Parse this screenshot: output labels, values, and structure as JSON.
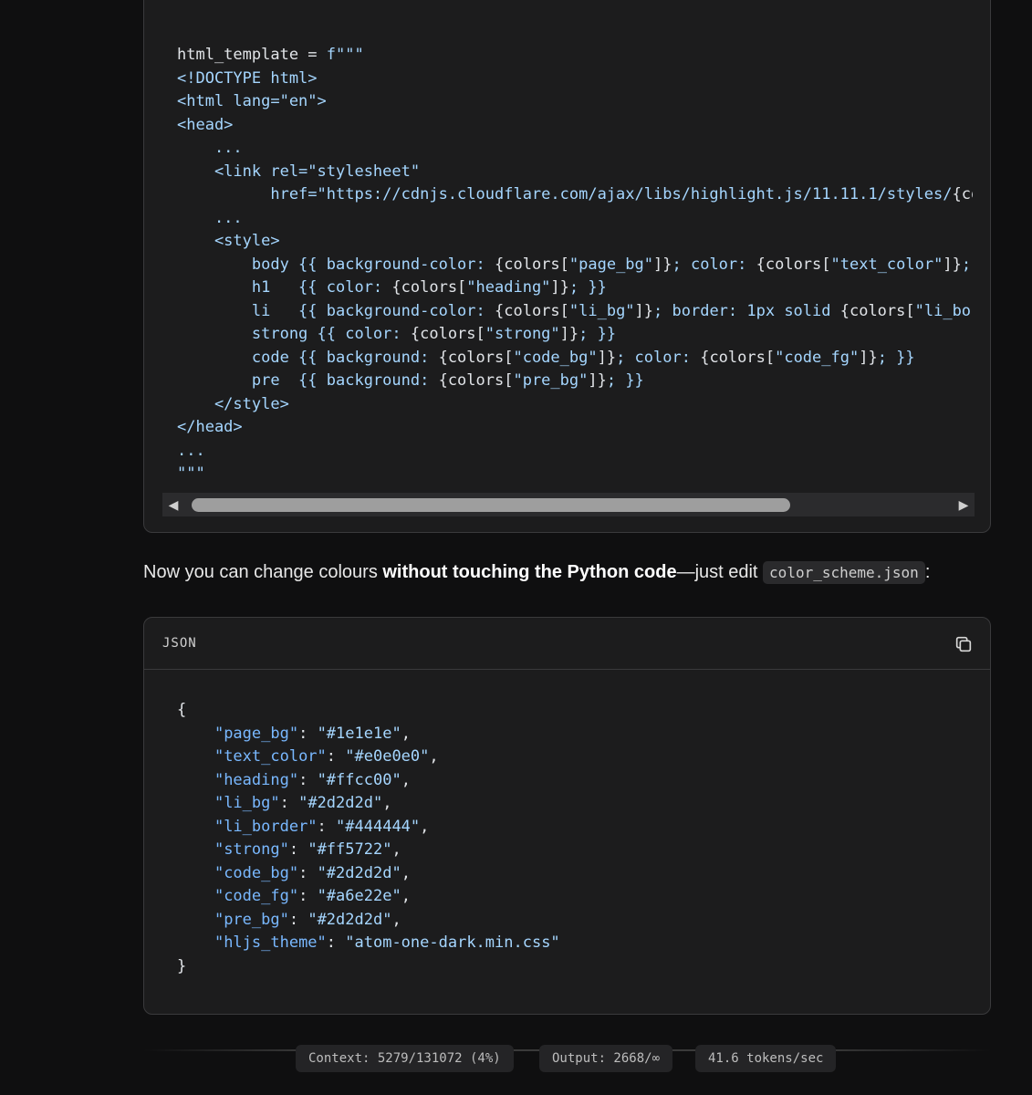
{
  "code_block_1": {
    "lines": [
      [
        {
          "t": "html_template = ",
          "c": "p"
        },
        {
          "t": "f\"\"\"",
          "c": "s"
        }
      ],
      [
        {
          "t": "<!DOCTYPE html>",
          "c": "s"
        }
      ],
      [
        {
          "t": "<html lang=\"en\">",
          "c": "s"
        }
      ],
      [
        {
          "t": "<head>",
          "c": "s"
        }
      ],
      [
        {
          "t": "    ...",
          "c": "s"
        }
      ],
      [
        {
          "t": "    <link rel=\"stylesheet\"",
          "c": "s"
        }
      ],
      [
        {
          "t": "          href=\"https://cdnjs.cloudflare.com/ajax/libs/highlight.js/11.11.1/styles/",
          "c": "s"
        },
        {
          "t": "{co",
          "c": "p"
        }
      ],
      [
        {
          "t": "    ...",
          "c": "s"
        }
      ],
      [
        {
          "t": "    <style>",
          "c": "s"
        }
      ],
      [
        {
          "t": "        body {{ background-color: ",
          "c": "s"
        },
        {
          "t": "{colors[",
          "c": "p"
        },
        {
          "t": "\"page_bg\"",
          "c": "s"
        },
        {
          "t": "]}",
          "c": "p"
        },
        {
          "t": "; color: ",
          "c": "s"
        },
        {
          "t": "{colors[",
          "c": "p"
        },
        {
          "t": "\"text_color\"",
          "c": "s"
        },
        {
          "t": "]}",
          "c": "p"
        },
        {
          "t": ";",
          "c": "s"
        }
      ],
      [
        {
          "t": "        h1   {{ color: ",
          "c": "s"
        },
        {
          "t": "{colors[",
          "c": "p"
        },
        {
          "t": "\"heading\"",
          "c": "s"
        },
        {
          "t": "]}",
          "c": "p"
        },
        {
          "t": "; }}",
          "c": "s"
        }
      ],
      [
        {
          "t": "        li   {{ background-color: ",
          "c": "s"
        },
        {
          "t": "{colors[",
          "c": "p"
        },
        {
          "t": "\"li_bg\"",
          "c": "s"
        },
        {
          "t": "]}",
          "c": "p"
        },
        {
          "t": "; border: 1px solid ",
          "c": "s"
        },
        {
          "t": "{colors[",
          "c": "p"
        },
        {
          "t": "\"li_bor",
          "c": "s"
        }
      ],
      [
        {
          "t": "        strong {{ color: ",
          "c": "s"
        },
        {
          "t": "{colors[",
          "c": "p"
        },
        {
          "t": "\"strong\"",
          "c": "s"
        },
        {
          "t": "]}",
          "c": "p"
        },
        {
          "t": "; }}",
          "c": "s"
        }
      ],
      [
        {
          "t": "        code {{ background: ",
          "c": "s"
        },
        {
          "t": "{colors[",
          "c": "p"
        },
        {
          "t": "\"code_bg\"",
          "c": "s"
        },
        {
          "t": "]}",
          "c": "p"
        },
        {
          "t": "; color: ",
          "c": "s"
        },
        {
          "t": "{colors[",
          "c": "p"
        },
        {
          "t": "\"code_fg\"",
          "c": "s"
        },
        {
          "t": "]}",
          "c": "p"
        },
        {
          "t": "; }}",
          "c": "s"
        }
      ],
      [
        {
          "t": "        pre  {{ background: ",
          "c": "s"
        },
        {
          "t": "{colors[",
          "c": "p"
        },
        {
          "t": "\"pre_bg\"",
          "c": "s"
        },
        {
          "t": "]}",
          "c": "p"
        },
        {
          "t": "; }}",
          "c": "s"
        }
      ],
      [
        {
          "t": "    </style>",
          "c": "s"
        }
      ],
      [
        {
          "t": "</head>",
          "c": "s"
        }
      ],
      [
        {
          "t": "...",
          "c": "s"
        }
      ],
      [
        {
          "t": "\"\"\"",
          "c": "s"
        }
      ]
    ],
    "scrollbar": {
      "left_arrow": "◀",
      "right_arrow": "▶",
      "thumb_fraction": 0.74
    }
  },
  "prose": {
    "before": "Now you can change colours ",
    "bold": "without touching the Python code",
    "after": "—just edit ",
    "inline_code": "color_scheme.json",
    "end": ":"
  },
  "code_block_2": {
    "language": "JSON",
    "copy_icon": "copy-icon",
    "lines": [
      [
        {
          "t": "{",
          "c": "p"
        }
      ],
      [
        {
          "t": "    ",
          "c": "p"
        },
        {
          "t": "\"page_bg\"",
          "c": "k"
        },
        {
          "t": ": ",
          "c": "p"
        },
        {
          "t": "\"#1e1e1e\"",
          "c": "s"
        },
        {
          "t": ",",
          "c": "p"
        }
      ],
      [
        {
          "t": "    ",
          "c": "p"
        },
        {
          "t": "\"text_color\"",
          "c": "k"
        },
        {
          "t": ": ",
          "c": "p"
        },
        {
          "t": "\"#e0e0e0\"",
          "c": "s"
        },
        {
          "t": ",",
          "c": "p"
        }
      ],
      [
        {
          "t": "    ",
          "c": "p"
        },
        {
          "t": "\"heading\"",
          "c": "k"
        },
        {
          "t": ": ",
          "c": "p"
        },
        {
          "t": "\"#ffcc00\"",
          "c": "s"
        },
        {
          "t": ",",
          "c": "p"
        }
      ],
      [
        {
          "t": "    ",
          "c": "p"
        },
        {
          "t": "\"li_bg\"",
          "c": "k"
        },
        {
          "t": ": ",
          "c": "p"
        },
        {
          "t": "\"#2d2d2d\"",
          "c": "s"
        },
        {
          "t": ",",
          "c": "p"
        }
      ],
      [
        {
          "t": "    ",
          "c": "p"
        },
        {
          "t": "\"li_border\"",
          "c": "k"
        },
        {
          "t": ": ",
          "c": "p"
        },
        {
          "t": "\"#444444\"",
          "c": "s"
        },
        {
          "t": ",",
          "c": "p"
        }
      ],
      [
        {
          "t": "    ",
          "c": "p"
        },
        {
          "t": "\"strong\"",
          "c": "k"
        },
        {
          "t": ": ",
          "c": "p"
        },
        {
          "t": "\"#ff5722\"",
          "c": "s"
        },
        {
          "t": ",",
          "c": "p"
        }
      ],
      [
        {
          "t": "    ",
          "c": "p"
        },
        {
          "t": "\"code_bg\"",
          "c": "k"
        },
        {
          "t": ": ",
          "c": "p"
        },
        {
          "t": "\"#2d2d2d\"",
          "c": "s"
        },
        {
          "t": ",",
          "c": "p"
        }
      ],
      [
        {
          "t": "    ",
          "c": "p"
        },
        {
          "t": "\"code_fg\"",
          "c": "k"
        },
        {
          "t": ": ",
          "c": "p"
        },
        {
          "t": "\"#a6e22e\"",
          "c": "s"
        },
        {
          "t": ",",
          "c": "p"
        }
      ],
      [
        {
          "t": "    ",
          "c": "p"
        },
        {
          "t": "\"pre_bg\"",
          "c": "k"
        },
        {
          "t": ": ",
          "c": "p"
        },
        {
          "t": "\"#2d2d2d\"",
          "c": "s"
        },
        {
          "t": ",",
          "c": "p"
        }
      ],
      [
        {
          "t": "    ",
          "c": "p"
        },
        {
          "t": "\"hljs_theme\"",
          "c": "k"
        },
        {
          "t": ": ",
          "c": "p"
        },
        {
          "t": "\"atom-one-dark.min.css\"",
          "c": "s"
        }
      ],
      [
        {
          "t": "}",
          "c": "p"
        }
      ]
    ]
  },
  "footer": {
    "context": "Context: 5279/131072 (4%)",
    "output": "Output: 2668/∞",
    "speed": "41.6 tokens/sec"
  }
}
